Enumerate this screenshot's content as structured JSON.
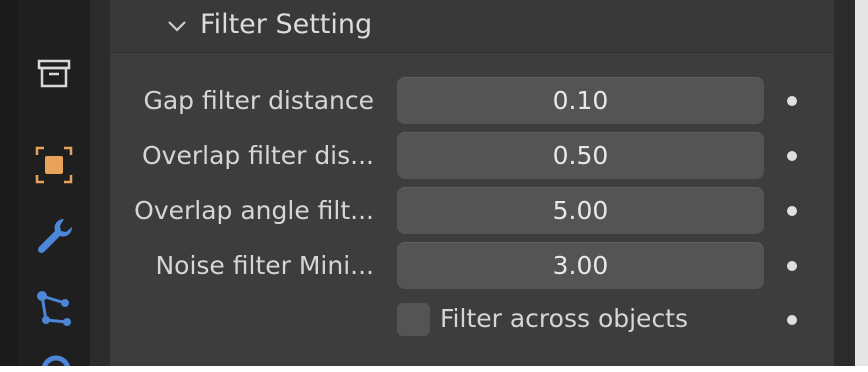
{
  "panel": {
    "title": "Filter Setting",
    "expanded_icon": "chevron-down-icon"
  },
  "properties": [
    {
      "label": "Gap filter distance",
      "value": "0.10"
    },
    {
      "label": "Overlap filter dis...",
      "value": "0.50"
    },
    {
      "label": "Overlap angle filt...",
      "value": "5.00"
    },
    {
      "label": "Noise filter Mini...",
      "value": "3.00"
    }
  ],
  "checkbox": {
    "label": "Filter across objects",
    "checked": false
  },
  "tabs": [
    {
      "icon": "archive-icon"
    },
    {
      "icon": "object-icon",
      "color": "#e8a25a"
    },
    {
      "icon": "wrench-icon",
      "color": "#4b86d8"
    },
    {
      "icon": "particles-icon",
      "color": "#4b86d8"
    },
    {
      "icon": "physics-icon",
      "color": "#4b86d8"
    }
  ],
  "colors": {
    "panel_bg": "#3d3d3d",
    "field_bg": "#545454",
    "text": "#d6d6d6",
    "accent_blue": "#4b86d8",
    "accent_orange": "#e8a25a"
  }
}
